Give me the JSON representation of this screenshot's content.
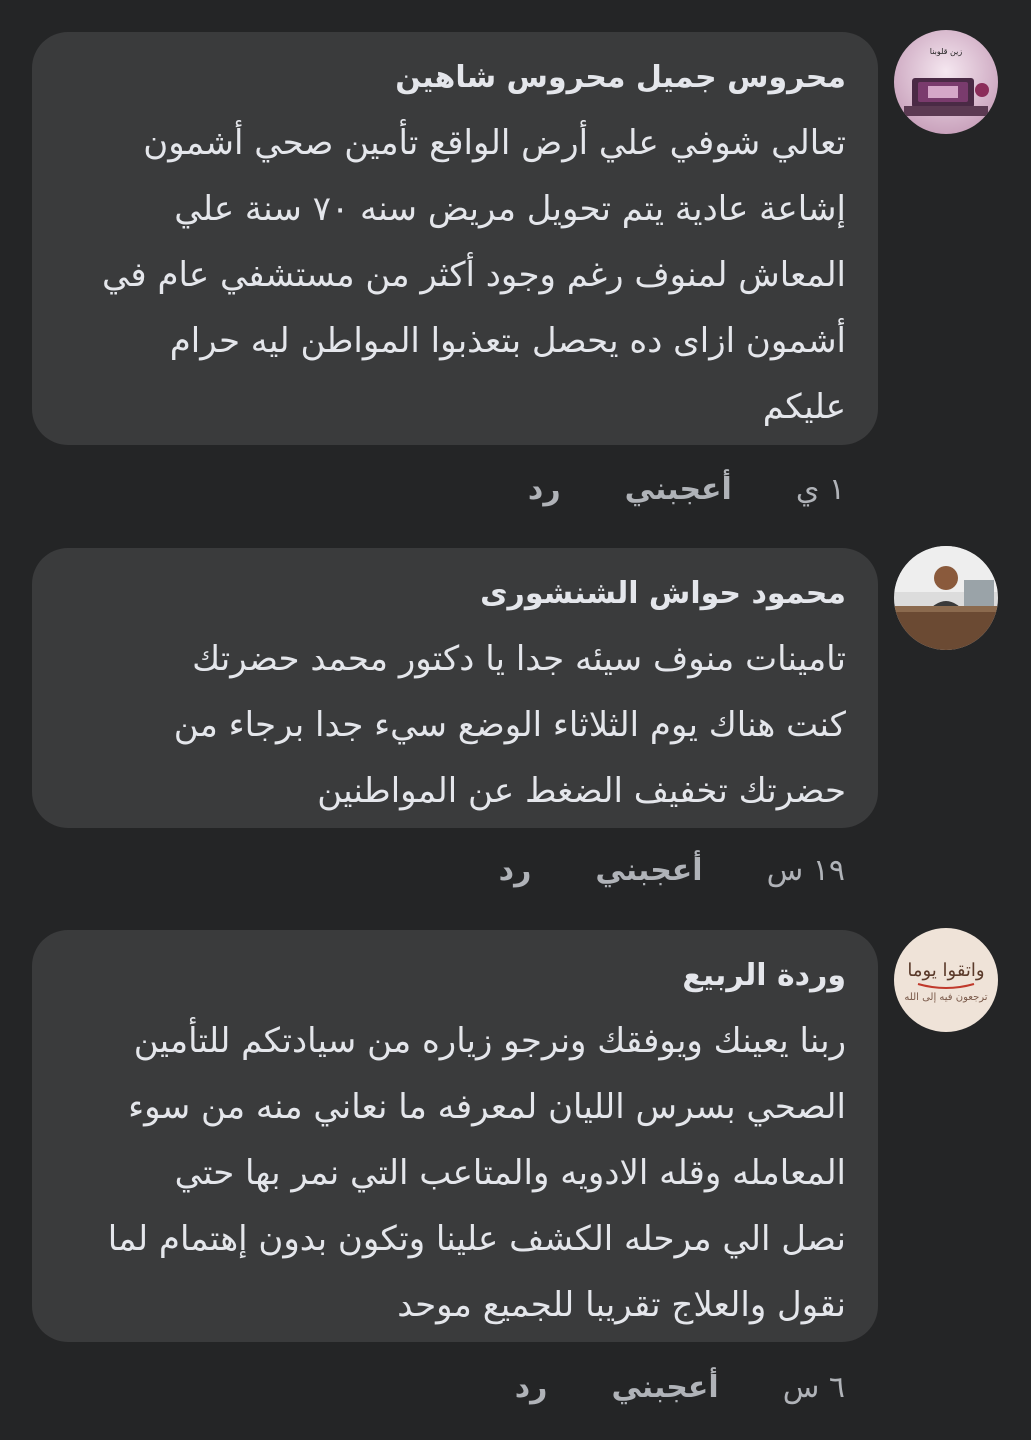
{
  "comments": [
    {
      "author": "محروس جميل محروس شاهين",
      "text": "تعالي شوفي علي أرض الواقع تأمين صحي أشمون\nإشاعة عادية يتم تحويل مريض سنه ٧٠ سنة علي\nالمعاش لمنوف رغم وجود أكثر من مستشفي عام في\nأشمون ازاى ده يحصل بتعذبوا المواطن ليه حرام\nعليكم",
      "time": "١ ي",
      "like_label": "أعجبني",
      "reply_label": "رد",
      "avatar_icon": "quran-book-avatar-icon",
      "avatar_text": "زين قلوبنا وقلوب بالقرآن و اجعل صدورنا مضيئة بذكرك"
    },
    {
      "author": "محمود حواش الشنشورى",
      "text": "تامينات منوف سيئه جدا يا دكتور محمد حضرتك\nكنت هناك يوم الثلاثاء الوضع سيء جدا برجاء من\nحضرتك تخفيف الضغط عن المواطنين",
      "time": "١٩ س",
      "like_label": "أعجبني",
      "reply_label": "رد",
      "avatar_icon": "person-at-desk-avatar-icon"
    },
    {
      "author": "وردة الربيع",
      "text": "ربنا يعينك ويوفقك ونرجو زياره من سيادتكم للتأمين\nالصحي بسرس الليان لمعرفه ما نعاني منه من سوء\nالمعامله وقله الادويه والمتاعب التي نمر بها حتي\nنصل الي مرحله الكشف علينا وتكون بدون إهتمام لما\nنقول  والعلاج تقريبا للجميع موحد",
      "time": "٦ س",
      "like_label": "أعجبني",
      "reply_label": "رد",
      "avatar_icon": "calligraphy-avatar-icon",
      "avatar_text": "واتقوا يوما ترجعون فيه إلى الله"
    }
  ],
  "colors": {
    "background": "#242526",
    "bubble": "#3a3b3c",
    "primary_text": "#e4e6eb",
    "secondary_text": "#b0b3b8"
  }
}
